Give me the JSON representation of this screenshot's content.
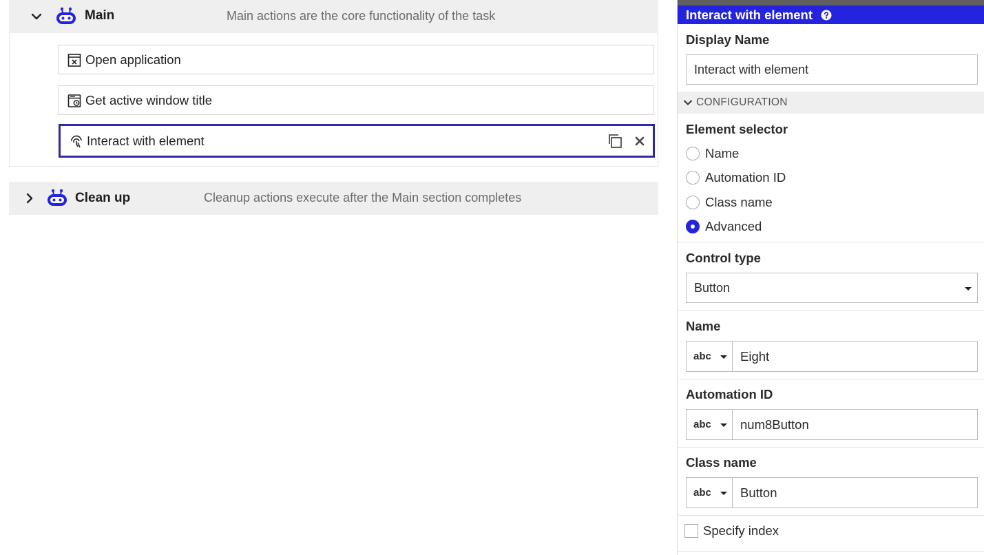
{
  "workflow": {
    "main": {
      "title": "Main",
      "description": "Main actions are the core functionality of the task",
      "expanded": true,
      "actions": [
        {
          "label": "Open application",
          "icon": "open-application-icon"
        },
        {
          "label": "Get active window title",
          "icon": "window-title-icon"
        },
        {
          "label": "Interact with element",
          "icon": "fingerprint-icon",
          "selected": true
        }
      ]
    },
    "cleanup": {
      "title": "Clean up",
      "description": "Cleanup actions execute after the Main section completes",
      "expanded": false
    }
  },
  "panel": {
    "title": "Interact with element",
    "display_name_label": "Display Name",
    "display_name_value": "Interact with element",
    "config_header": "CONFIGURATION",
    "element_selector_label": "Element selector",
    "selector_options": [
      "Name",
      "Automation ID",
      "Class name",
      "Advanced"
    ],
    "selector_selected": "Advanced",
    "control_type_label": "Control type",
    "control_type_value": "Button",
    "name_label": "Name",
    "name_type": "abc",
    "name_value": "Eight",
    "automation_id_label": "Automation ID",
    "automation_id_type": "abc",
    "automation_id_value": "num8Button",
    "class_name_label": "Class name",
    "class_name_type": "abc",
    "class_name_value": "Button",
    "specify_index_label": "Specify index"
  },
  "colors": {
    "accent": "#2424e0",
    "selected_border": "#2b2ba6",
    "section_bg": "#efefef"
  }
}
